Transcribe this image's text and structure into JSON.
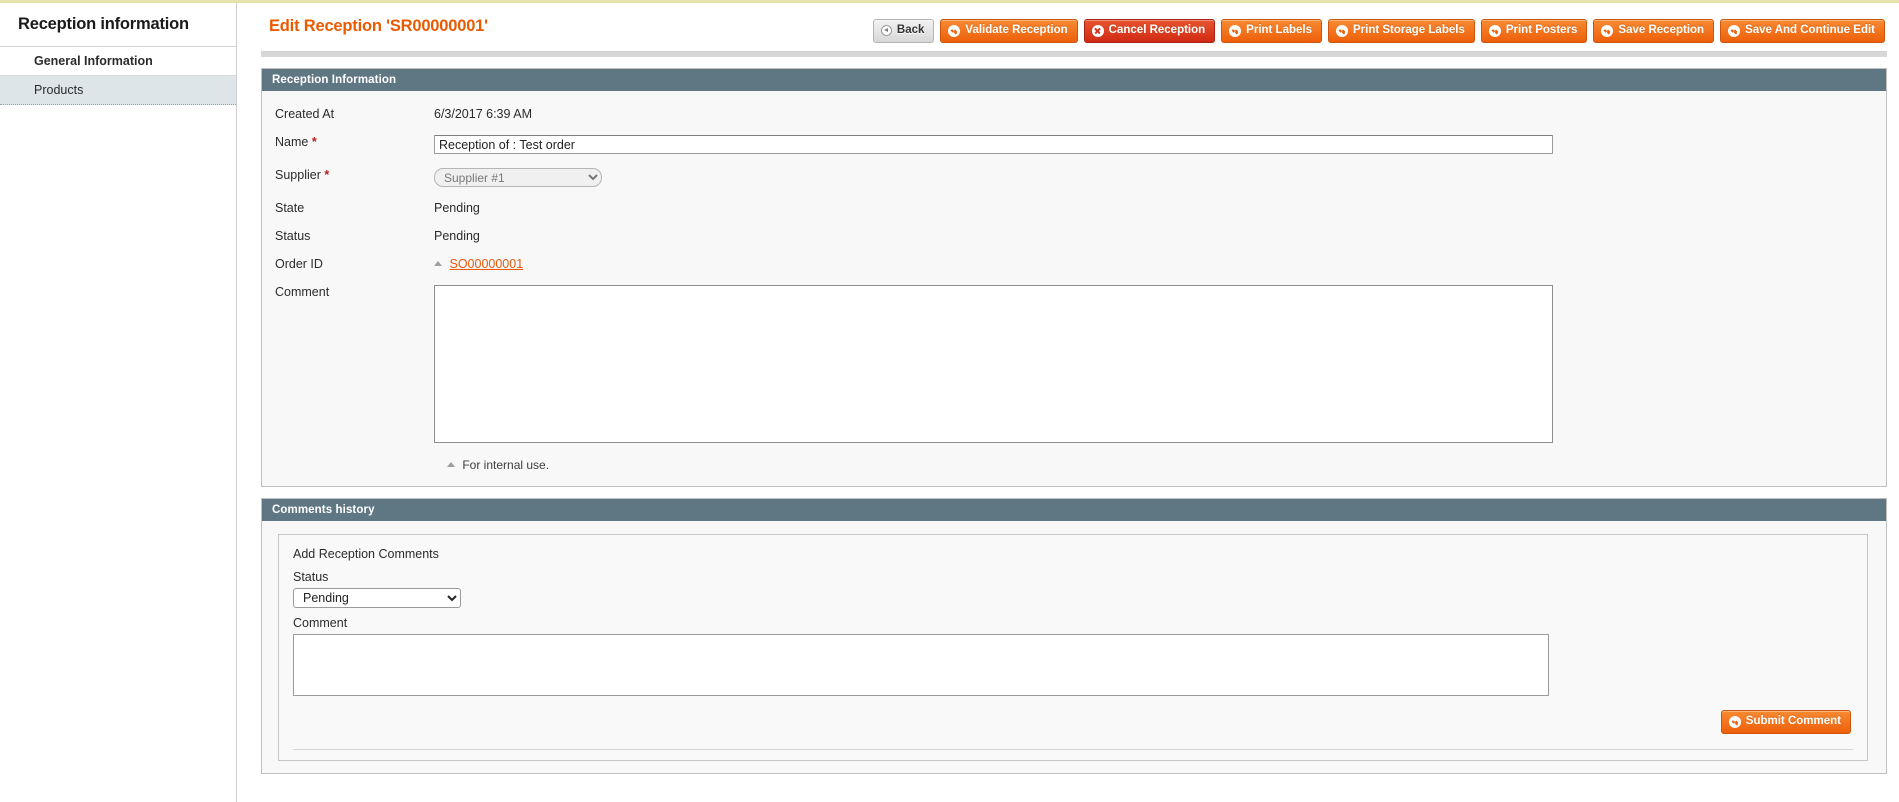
{
  "sidebar": {
    "title": "Reception information",
    "items": [
      {
        "label": "General Information",
        "state": "active"
      },
      {
        "label": "Products",
        "state": "shaded"
      }
    ]
  },
  "header": {
    "title": "Edit Reception 'SR00000001'",
    "buttons": [
      {
        "label": "Back",
        "style": "grey",
        "icon": "back-arrow-icon"
      },
      {
        "label": "Validate Reception",
        "style": "orange",
        "icon": "check-circle-icon"
      },
      {
        "label": "Cancel Reception",
        "style": "cancel",
        "icon": "cross-circle-icon"
      },
      {
        "label": "Print Labels",
        "style": "orange",
        "icon": "check-circle-icon"
      },
      {
        "label": "Print Storage Labels",
        "style": "orange",
        "icon": "check-circle-icon"
      },
      {
        "label": "Print Posters",
        "style": "orange",
        "icon": "check-circle-icon"
      },
      {
        "label": "Save Reception",
        "style": "orange",
        "icon": "check-circle-icon"
      },
      {
        "label": "Save And Continue Edit",
        "style": "orange",
        "icon": "check-circle-icon"
      }
    ]
  },
  "reception_panel": {
    "heading": "Reception Information",
    "created_at_label": "Created At",
    "created_at_value": "6/3/2017 6:39 AM",
    "name_label": "Name",
    "name_value": "Reception of : Test order",
    "supplier_label": "Supplier",
    "supplier_value": "Supplier #1",
    "supplier_options": [
      "Supplier #1"
    ],
    "state_label": "State",
    "state_value": "Pending",
    "status_label": "Status",
    "status_value": "Pending",
    "order_id_label": "Order ID",
    "order_id_value": "SO00000001",
    "comment_label": "Comment",
    "comment_value": "",
    "comment_note": "For internal use.",
    "required_marker": "*"
  },
  "comments_panel": {
    "heading": "Comments history",
    "add_heading": "Add Reception Comments",
    "status_label": "Status",
    "status_value": "Pending",
    "status_options": [
      "Pending"
    ],
    "comment_label": "Comment",
    "comment_value": "",
    "submit_label": "Submit Comment"
  },
  "colors": {
    "accent_orange": "#eb5a00",
    "panel_header": "#5f7783",
    "link_orange": "#ea5a0b",
    "top_rule": "#e8e3ad",
    "sidebar_shade": "#dde5e8"
  }
}
